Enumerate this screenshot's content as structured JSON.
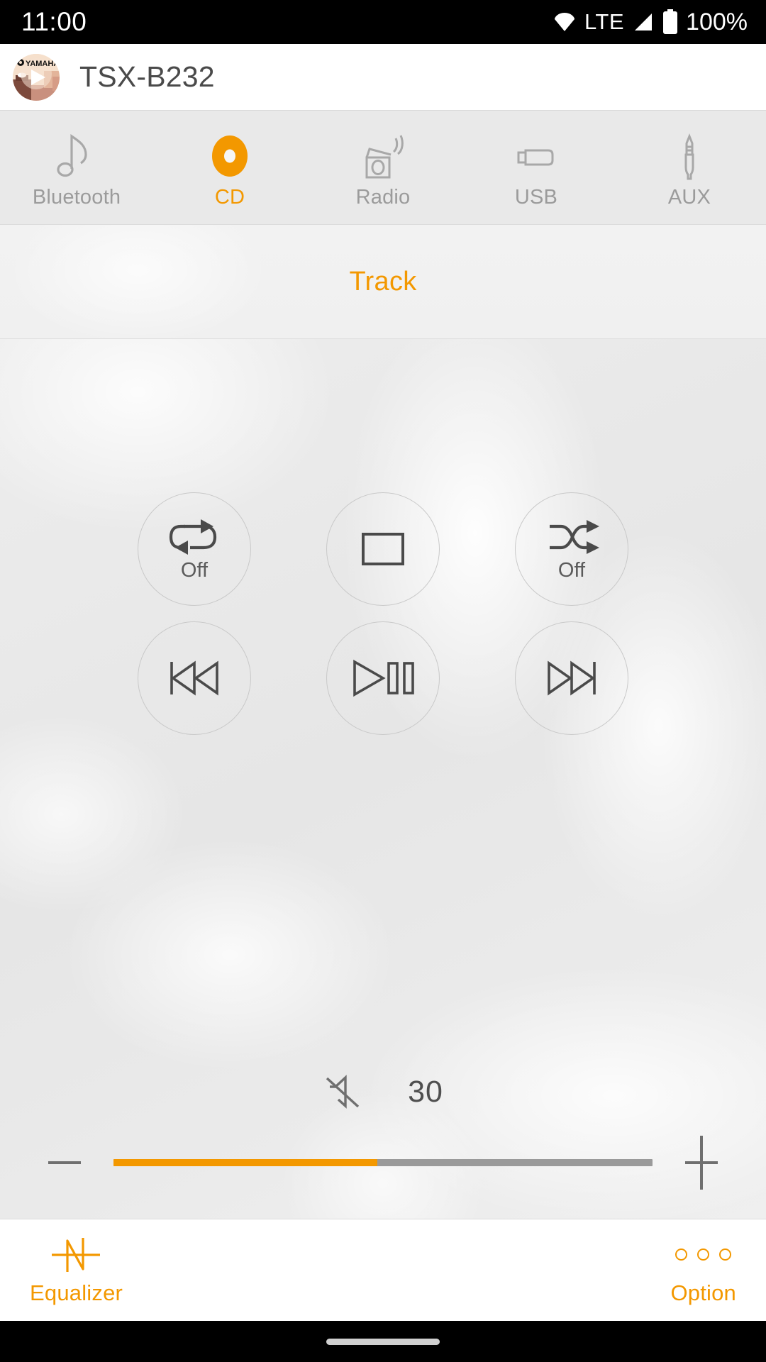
{
  "status_bar": {
    "clock": "11:00",
    "network_type": "LTE",
    "battery_text": "100%",
    "icons": [
      "wifi-icon",
      "signal-icon",
      "battery-icon"
    ]
  },
  "app_bar": {
    "icon": "yamaha-app-icon",
    "title": "TSX-B232"
  },
  "sources": {
    "items": [
      {
        "label": "Bluetooth",
        "icon": "music-note-icon",
        "active": false
      },
      {
        "label": "CD",
        "icon": "cd-disc-icon",
        "active": true
      },
      {
        "label": "Radio",
        "icon": "radio-icon",
        "active": false
      },
      {
        "label": "USB",
        "icon": "usb-icon",
        "active": false
      },
      {
        "label": "AUX",
        "icon": "aux-plug-icon",
        "active": false
      }
    ]
  },
  "now_playing": {
    "track_label": "Track"
  },
  "transport": {
    "repeat": {
      "icon": "repeat-icon",
      "label": "Off"
    },
    "stop": {
      "icon": "stop-icon",
      "label": ""
    },
    "shuffle": {
      "icon": "shuffle-icon",
      "label": "Off"
    },
    "previous": {
      "icon": "previous-track-icon"
    },
    "play_pause": {
      "icon": "play-pause-icon"
    },
    "next": {
      "icon": "next-track-icon"
    }
  },
  "volume": {
    "mute_icon": "mute-icon",
    "value": "30",
    "minus_label": "−",
    "plus_label": "+",
    "fill_percent": 49
  },
  "bottom_bar": {
    "equalizer": {
      "label": "Equalizer",
      "icon": "equalizer-waveform-icon"
    },
    "option": {
      "label": "Option",
      "icon": "three-dots-icon"
    }
  },
  "colors": {
    "accent": "#f39800",
    "text_primary": "#4a4a4a",
    "text_muted": "#9b9b9b",
    "source_bar_bg": "#e9e9e9",
    "status_bar_bg": "#000000"
  }
}
